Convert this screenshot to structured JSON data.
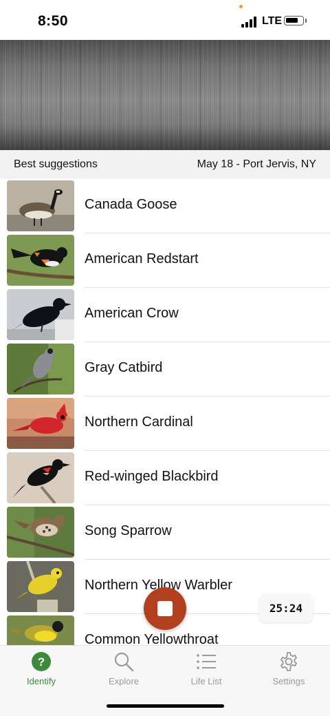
{
  "status_bar": {
    "time": "8:50",
    "network": "LTE"
  },
  "section_header": {
    "left": "Best suggestions",
    "right": "May 18 - Port Jervis, NY"
  },
  "birds": [
    {
      "name": "Canada Goose"
    },
    {
      "name": "American Redstart"
    },
    {
      "name": "American Crow"
    },
    {
      "name": "Gray Catbird"
    },
    {
      "name": "Northern Cardinal"
    },
    {
      "name": "Red-winged Blackbird"
    },
    {
      "name": "Song Sparrow"
    },
    {
      "name": "Northern Yellow Warbler"
    },
    {
      "name": "Common Yellowthroat"
    }
  ],
  "recorder": {
    "timer": "25:24"
  },
  "tabs": [
    {
      "label": "Identify",
      "icon": "question-circle-icon",
      "active": true
    },
    {
      "label": "Explore",
      "icon": "search-icon",
      "active": false
    },
    {
      "label": "Life List",
      "icon": "list-icon",
      "active": false
    },
    {
      "label": "Settings",
      "icon": "gear-icon",
      "active": false
    }
  ],
  "colors": {
    "accent_green": "#3c8a3c",
    "record_button": "#b2401e",
    "status_dot": "#f19a37"
  }
}
